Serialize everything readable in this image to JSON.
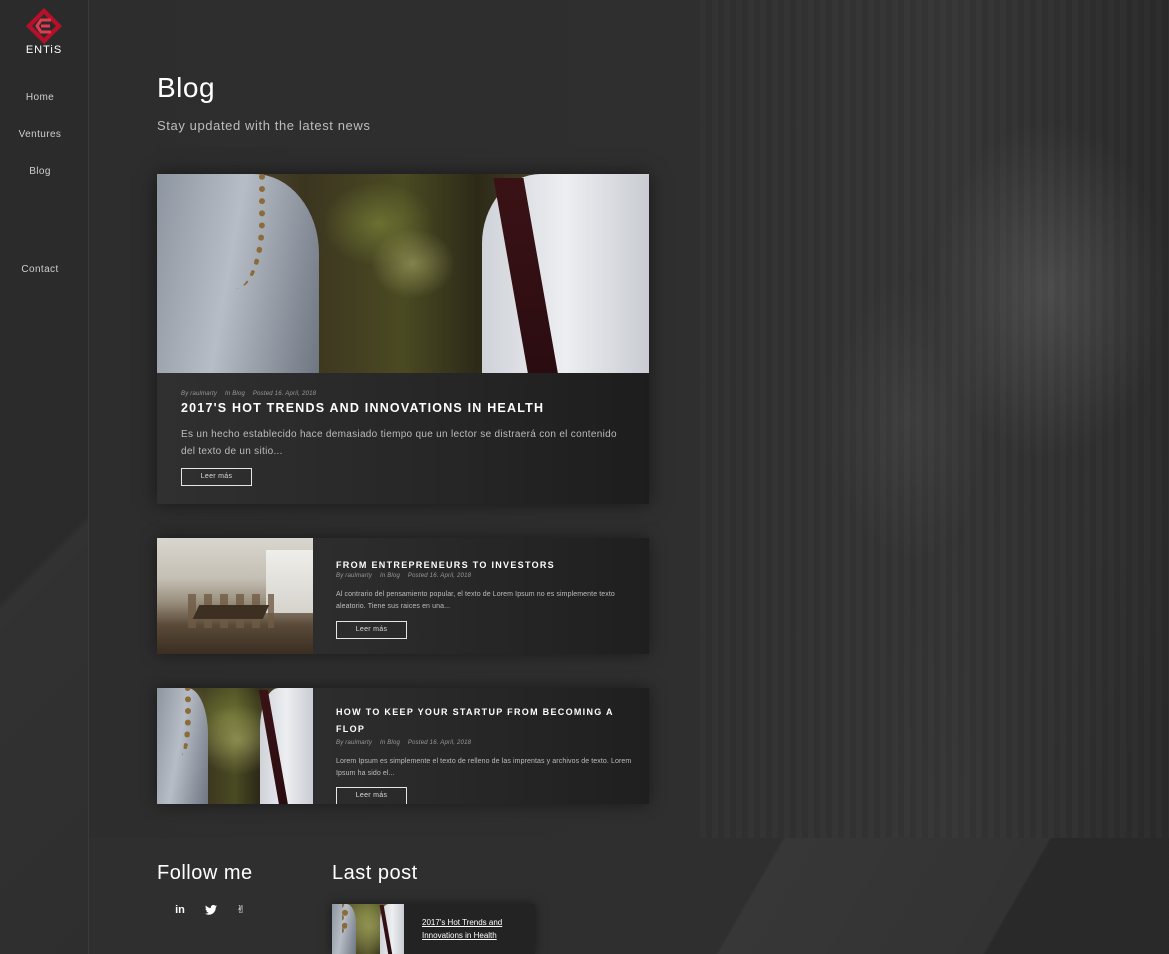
{
  "brand": {
    "logo_text": "ENTiS",
    "accent": "#c8102e"
  },
  "nav": {
    "items": [
      {
        "label": "Home"
      },
      {
        "label": "Ventures"
      },
      {
        "label": "Blog"
      },
      {
        "label": "Contact"
      }
    ]
  },
  "header": {
    "title": "Blog",
    "subtitle": "Stay updated with the latest news"
  },
  "featured_post": {
    "meta": {
      "author": "By raulmarty",
      "category": "In Blog",
      "posted": "Posted 16. April, 2018"
    },
    "title": "2017'S HOT TRENDS AND INNOVATIONS IN HEALTH",
    "excerpt": "Es un hecho establecido hace demasiado tiempo que un lector se distraerá con el contenido del texto de un sitio...",
    "read_more": "Leer más"
  },
  "posts": [
    {
      "title": "FROM ENTREPRENEURS TO INVESTORS",
      "meta": {
        "author": "By raulmarty",
        "category": "In Blog",
        "posted": "Posted 16. April, 2018"
      },
      "excerpt": "Al contrario del pensamiento popular, el texto de Lorem Ipsum no es simplemente texto aleatorio. Tiene sus raices en una...",
      "read_more": "Leer más"
    },
    {
      "title": "HOW TO KEEP YOUR STARTUP FROM BECOMING A FLOP",
      "meta": {
        "author": "By raulmarty",
        "category": "In Blog",
        "posted": "Posted 16. April, 2018"
      },
      "excerpt": "Lorem Ipsum es simplemente el texto de relleno de las imprentas y archivos de texto. Lorem Ipsum ha sido el...",
      "read_more": "Leer más"
    }
  ],
  "footer": {
    "follow_heading": "Follow me",
    "social": [
      {
        "icon": "linkedin-icon",
        "glyph": "in"
      },
      {
        "icon": "twitter-icon",
        "glyph": "🐦"
      },
      {
        "icon": "angellist-icon",
        "glyph": "✌"
      }
    ],
    "last_post_heading": "Last post",
    "last_post_title": "2017's Hot Trends and Innovations in Health"
  }
}
